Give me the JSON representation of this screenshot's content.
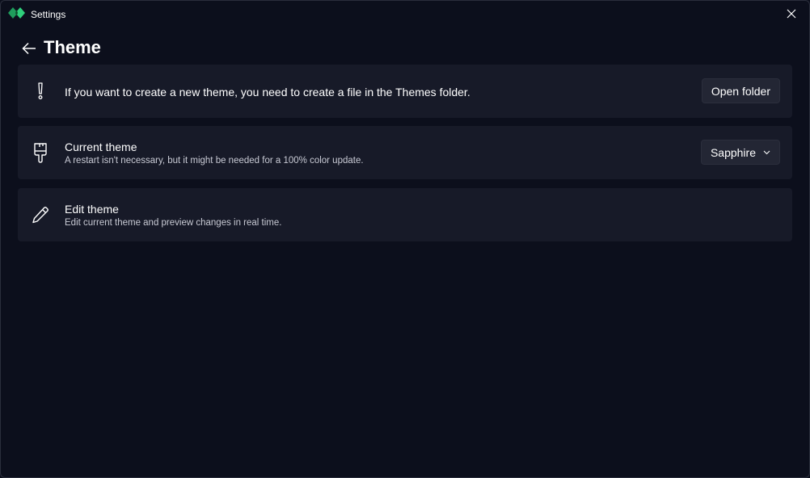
{
  "window": {
    "title": "Settings"
  },
  "page": {
    "title": "Theme"
  },
  "cards": {
    "info": {
      "text": "If you want to create a new theme, you need to create a file in the Themes folder.",
      "button_label": "Open folder",
      "icon": "exclamation-icon"
    },
    "current_theme": {
      "title": "Current theme",
      "description": "A restart isn't necessary, but it might be needed for a 100% color update.",
      "selected_value": "Sapphire",
      "icon": "paintbrush-icon"
    },
    "edit_theme": {
      "title": "Edit theme",
      "description": "Edit current theme and preview changes in real time.",
      "icon": "pencil-icon"
    }
  },
  "colors": {
    "background": "#0c0f1c",
    "card": "#171a28",
    "button": "#232634",
    "logo_green": "#2ecc71",
    "logo_dark": "#1a7a4a"
  }
}
